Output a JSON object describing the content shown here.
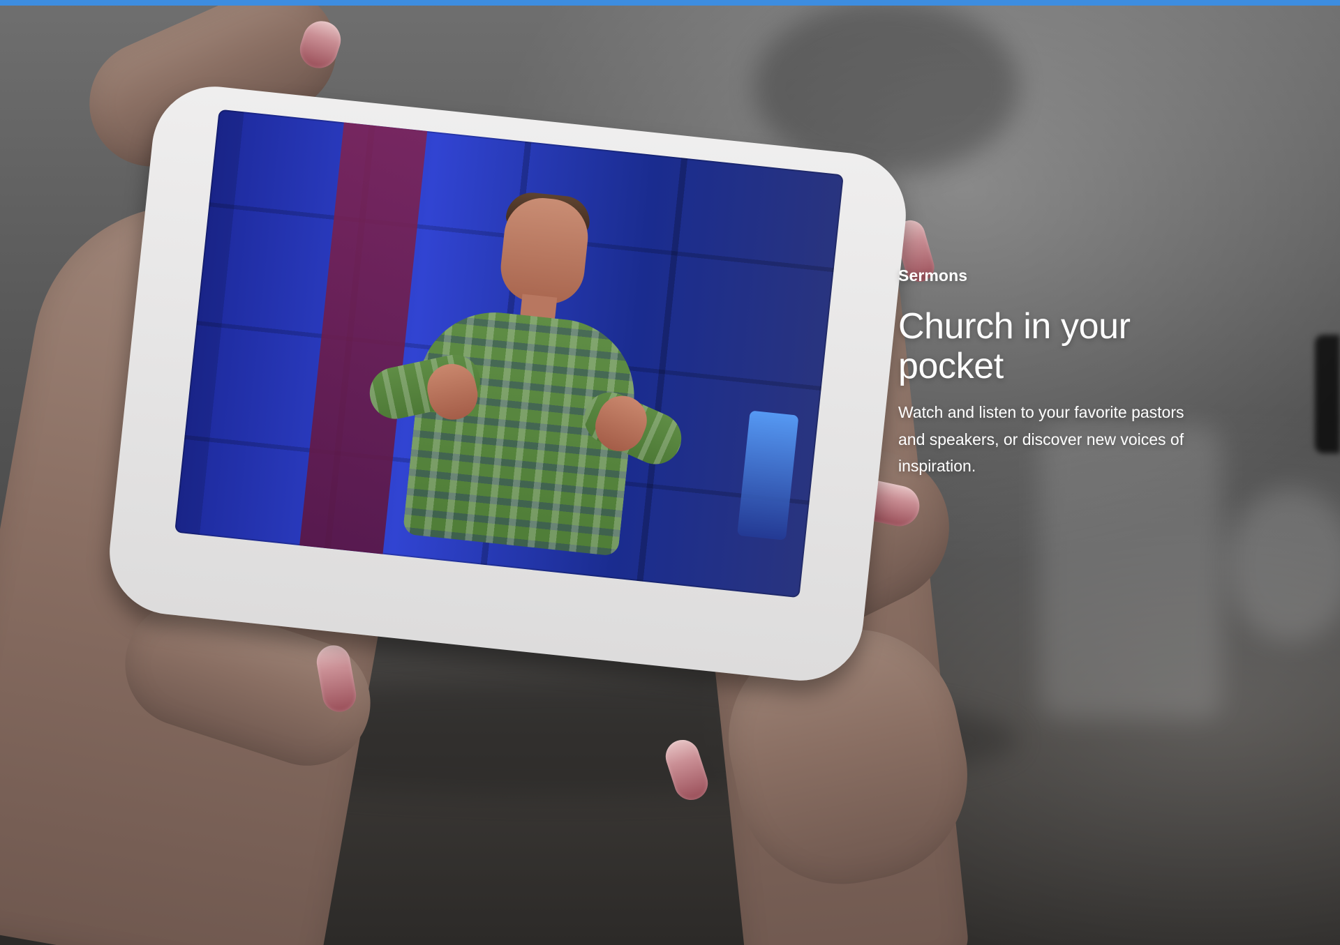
{
  "section": {
    "eyebrow": "Sermons",
    "title": "Church in your pocket",
    "description": "Watch and listen to your favorite pastors and speakers, or discover new voices of inspiration."
  },
  "visuals": {
    "accent_bar_color": "#3d8de0",
    "phone_frame_color": "#efeeee",
    "screen_stage_color": "#3144d2",
    "speaker_shirt_color": "#5f8d45"
  }
}
